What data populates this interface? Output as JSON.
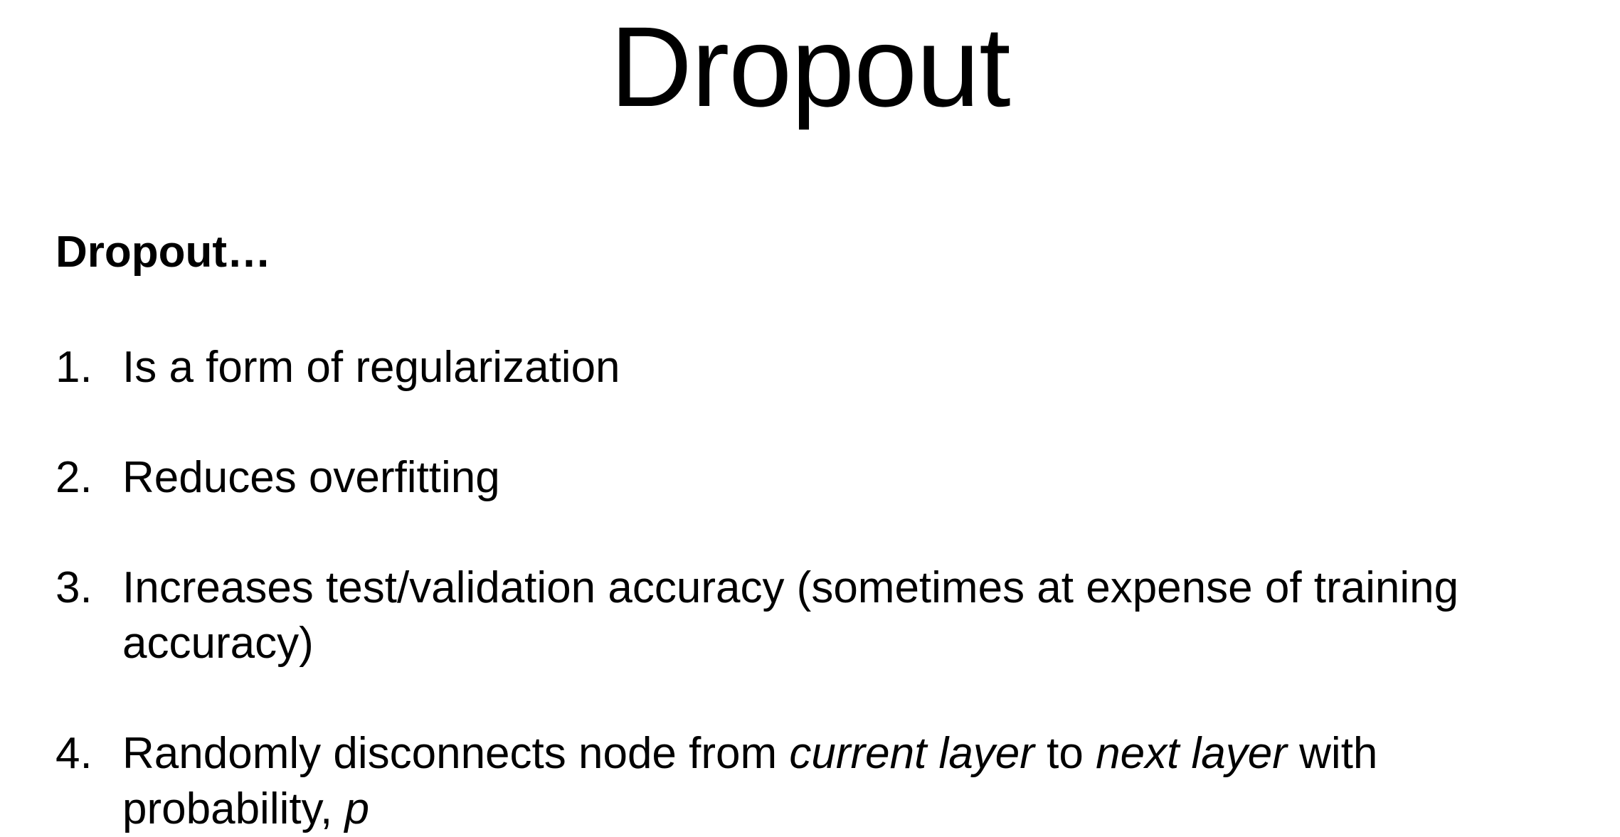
{
  "slide": {
    "title": "Dropout",
    "subheading": "Dropout…",
    "points": [
      {
        "number": "1.",
        "text": "Is a form of regularization"
      },
      {
        "number": "2.",
        "text": "Reduces overfitting"
      },
      {
        "number": "3.",
        "text": "Increases test/validation accuracy (sometimes at expense of training accuracy)"
      },
      {
        "number": "4.",
        "text_a": "Randomly disconnects node from ",
        "em_a": "current layer",
        "text_b": " to ",
        "em_b": "next layer",
        "text_c": " with probability, ",
        "em_c": "p"
      }
    ]
  }
}
